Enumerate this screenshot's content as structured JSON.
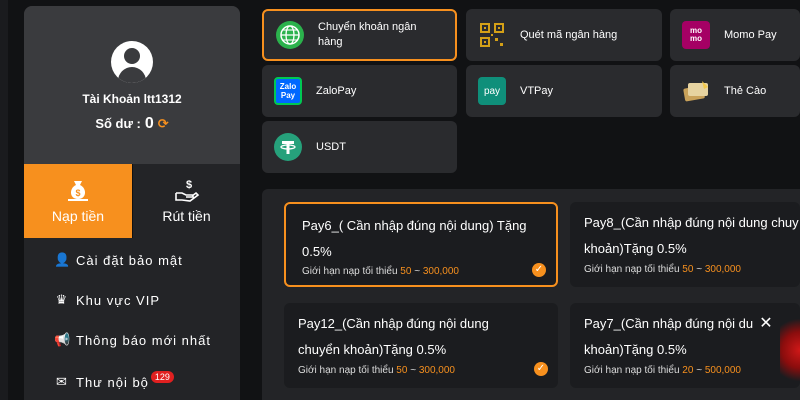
{
  "sidebar": {
    "account_label": "Tài Khoản ltt1312",
    "balance_label": "Số dư :",
    "balance_value": "0",
    "tabs": {
      "deposit": "Nạp tiền",
      "withdraw": "Rút tiền"
    },
    "menu": [
      {
        "label": "Cài đặt bảo mật"
      },
      {
        "label": "Khu vực VIP"
      },
      {
        "label": "Thông báo mới nhất"
      },
      {
        "label": "Thư nội bộ",
        "badge": "129"
      }
    ]
  },
  "methods": [
    {
      "label": "Chuyển khoản ngân hàng",
      "icon": "globe-icon",
      "selected": true
    },
    {
      "label": "Quét mã ngân hàng",
      "icon": "qr-code-icon"
    },
    {
      "label": "Momo Pay",
      "icon": "momo-logo-icon"
    },
    {
      "label": "ZaloPay",
      "icon": "zalopay-logo-icon"
    },
    {
      "label": "VTPay",
      "icon": "vtpay-logo-icon"
    },
    {
      "label": "Thẻ Cào",
      "icon": "scratch-card-icon"
    },
    {
      "label": "USDT",
      "icon": "tether-logo-icon"
    }
  ],
  "channels": [
    {
      "title_line1": "Pay6_( Cần nhập đúng nội dung) Tặng",
      "title_line2": "0.5%",
      "limit_label": "Giới hạn nạp tối thiểu",
      "min": "50",
      "sep": "~",
      "max": "300,000",
      "selected": true
    },
    {
      "title_line1": "Pay8_(Cần nhập đúng nội dung chuy",
      "title_line2": "khoản)Tặng 0.5%",
      "limit_label": "Giới hạn nạp tối thiểu",
      "min": "50",
      "sep": "~",
      "max": "300,000"
    },
    {
      "title_line1": "Pay12_(Cần nhập đúng nội dung",
      "title_line2": "chuyển khoản)Tặng 0.5%",
      "limit_label": "Giới hạn nạp tối thiểu",
      "min": "50",
      "sep": "~",
      "max": "300,000",
      "checked": true
    },
    {
      "title_line1": "Pay7_(Cần nhập đúng nội du",
      "title_line2": "khoản)Tặng 0.5%",
      "limit_label": "Giới hạn nạp tối thiểu",
      "min": "20",
      "sep": "~",
      "max": "500,000"
    }
  ],
  "colors": {
    "accent": "#f7901e",
    "background": "#111214",
    "panel": "#232427",
    "profile": "#3a3b3e"
  },
  "icons": {
    "logo_text": {
      "momo": "mo\nmo",
      "zalo": "Zalo\nPay",
      "vtpay": "pay"
    }
  }
}
